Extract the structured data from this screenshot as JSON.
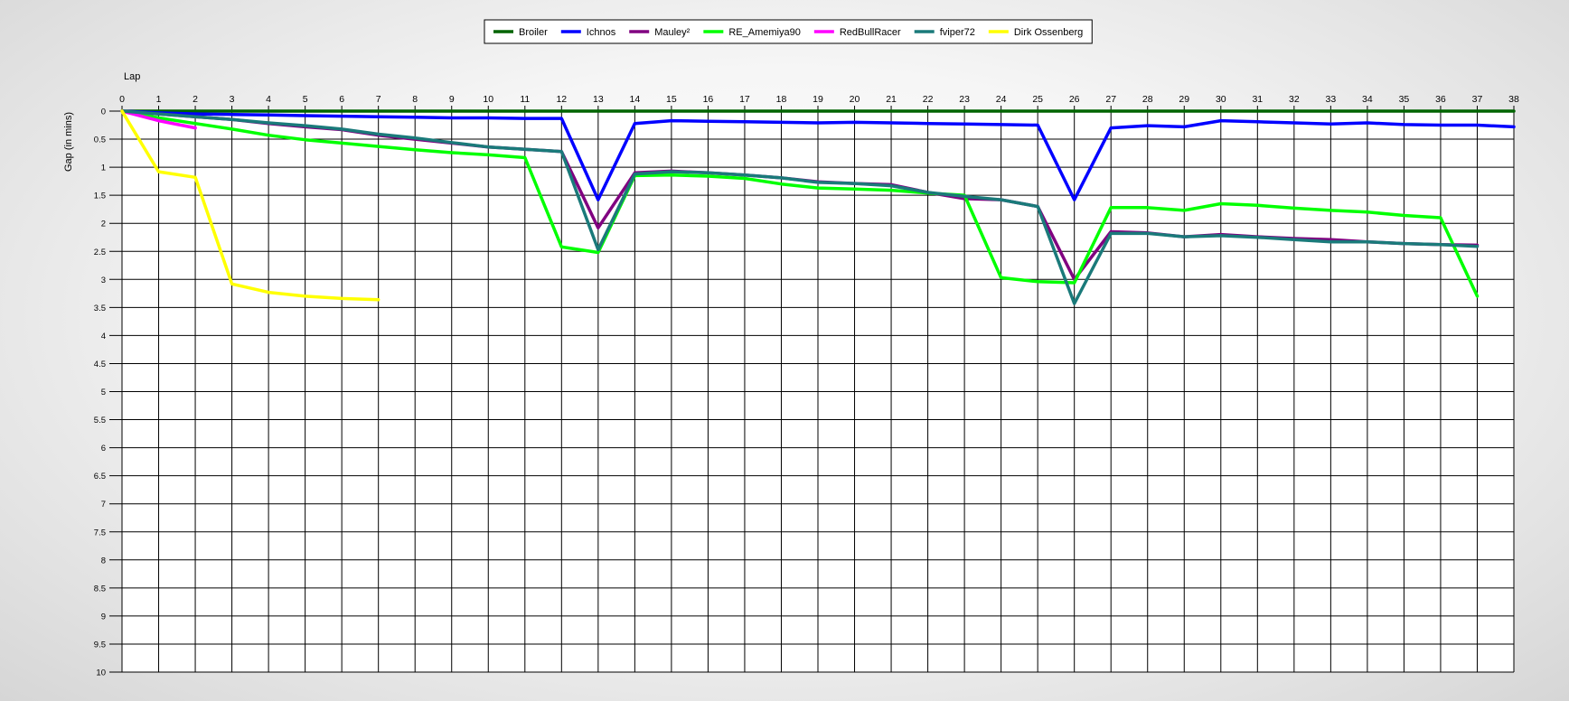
{
  "chart_data": {
    "type": "line",
    "xlabel": "Lap",
    "ylabel": "Gap (in mins)",
    "xlim": [
      0,
      38
    ],
    "ylim": [
      0,
      10
    ],
    "y_inverted": true,
    "x_ticks": [
      0,
      1,
      2,
      3,
      4,
      5,
      6,
      7,
      8,
      9,
      10,
      11,
      12,
      13,
      14,
      15,
      16,
      17,
      18,
      19,
      20,
      21,
      22,
      23,
      24,
      25,
      26,
      27,
      28,
      29,
      30,
      31,
      32,
      33,
      34,
      35,
      36,
      37,
      38
    ],
    "y_ticks": [
      "0",
      "0.5",
      "1",
      "1.5",
      "2",
      "2.5",
      "3",
      "3.5",
      "4",
      "4.5",
      "5",
      "5.5",
      "6",
      "6.5",
      "7",
      "7.5",
      "8",
      "8.5",
      "9",
      "9.5",
      "10"
    ],
    "grid": true,
    "legend_position": "top-center",
    "series": [
      {
        "name": "Broiler",
        "color": "#006400",
        "x": [
          0,
          1,
          2,
          3,
          4,
          5,
          6,
          7,
          8,
          9,
          10,
          11,
          12,
          13,
          14,
          15,
          16,
          17,
          18,
          19,
          20,
          21,
          22,
          23,
          24,
          25,
          26,
          27,
          28,
          29,
          30,
          31,
          32,
          33,
          34,
          35,
          36,
          37,
          38
        ],
        "y": [
          0,
          0,
          0,
          0,
          0,
          0,
          0,
          0,
          0,
          0,
          0,
          0,
          0,
          0,
          0,
          0,
          0,
          0,
          0,
          0,
          0,
          0,
          0,
          0,
          0,
          0,
          0,
          0,
          0,
          0,
          0,
          0,
          0,
          0,
          0,
          0,
          0,
          0,
          0
        ]
      },
      {
        "name": "Ichnos",
        "color": "#0000ff",
        "x": [
          0,
          1,
          2,
          3,
          4,
          5,
          6,
          7,
          8,
          9,
          10,
          11,
          12,
          13,
          14,
          15,
          16,
          17,
          18,
          19,
          20,
          21,
          22,
          23,
          24,
          25,
          26,
          27,
          28,
          29,
          30,
          31,
          32,
          33,
          34,
          35,
          36,
          37,
          38
        ],
        "y": [
          0,
          0.03,
          0.05,
          0.06,
          0.07,
          0.08,
          0.09,
          0.1,
          0.11,
          0.12,
          0.12,
          0.13,
          0.13,
          1.58,
          0.22,
          0.17,
          0.18,
          0.19,
          0.2,
          0.21,
          0.2,
          0.21,
          0.22,
          0.23,
          0.24,
          0.25,
          1.58,
          0.3,
          0.26,
          0.28,
          0.17,
          0.19,
          0.21,
          0.23,
          0.21,
          0.24,
          0.25,
          0.25,
          0.28
        ]
      },
      {
        "name": "Mauley²",
        "color": "#800080",
        "x": [
          0,
          1,
          2,
          3,
          4,
          5,
          6,
          7,
          8,
          9,
          10,
          11,
          12,
          13,
          14,
          15,
          16,
          17,
          18,
          19,
          20,
          21,
          22,
          23,
          24,
          25,
          26,
          27,
          28,
          29,
          30,
          31,
          32,
          33,
          34,
          35,
          36,
          37
        ],
        "y": [
          0,
          0.05,
          0.1,
          0.15,
          0.22,
          0.28,
          0.33,
          0.43,
          0.5,
          0.57,
          0.64,
          0.68,
          0.72,
          2.08,
          1.1,
          1.07,
          1.1,
          1.14,
          1.19,
          1.26,
          1.29,
          1.31,
          1.45,
          1.56,
          1.58,
          1.7,
          3.0,
          2.15,
          2.17,
          2.24,
          2.2,
          2.24,
          2.27,
          2.29,
          2.33,
          2.36,
          2.38,
          2.39
        ]
      },
      {
        "name": "RE_Amemiya90",
        "color": "#00ff00",
        "x": [
          0,
          1,
          2,
          3,
          4,
          5,
          6,
          7,
          8,
          9,
          10,
          11,
          12,
          13,
          14,
          15,
          16,
          17,
          18,
          19,
          20,
          21,
          22,
          23,
          24,
          25,
          26,
          27,
          28,
          29,
          30,
          31,
          32,
          33,
          34,
          35,
          36,
          37
        ],
        "y": [
          0,
          0.12,
          0.22,
          0.32,
          0.43,
          0.51,
          0.57,
          0.63,
          0.69,
          0.74,
          0.78,
          0.83,
          2.42,
          2.52,
          1.15,
          1.14,
          1.16,
          1.2,
          1.3,
          1.37,
          1.39,
          1.41,
          1.46,
          1.5,
          2.97,
          3.04,
          3.06,
          1.72,
          1.72,
          1.77,
          1.65,
          1.68,
          1.73,
          1.77,
          1.8,
          1.86,
          1.9,
          3.3
        ]
      },
      {
        "name": "RedBullRacer",
        "color": "#ff00ff",
        "x": [
          0,
          1,
          2
        ],
        "y": [
          0,
          0.17,
          0.3
        ]
      },
      {
        "name": "fviper72",
        "color": "#1a7a7a",
        "x": [
          0,
          1,
          2,
          3,
          4,
          5,
          6,
          7,
          8,
          9,
          10,
          11,
          12,
          13,
          14,
          15,
          16,
          17,
          18,
          19,
          20,
          21,
          22,
          23,
          24,
          25,
          26,
          27,
          28,
          29,
          30,
          31,
          32,
          33,
          34,
          35,
          36,
          37
        ],
        "y": [
          0,
          0.05,
          0.1,
          0.15,
          0.21,
          0.26,
          0.32,
          0.41,
          0.48,
          0.56,
          0.64,
          0.68,
          0.72,
          2.47,
          1.12,
          1.08,
          1.1,
          1.14,
          1.19,
          1.27,
          1.29,
          1.33,
          1.45,
          1.52,
          1.58,
          1.7,
          3.43,
          2.18,
          2.18,
          2.24,
          2.22,
          2.25,
          2.29,
          2.33,
          2.33,
          2.36,
          2.38,
          2.41
        ]
      },
      {
        "name": "Dirk Ossenberg",
        "color": "#ffff00",
        "x": [
          0,
          1,
          2,
          3,
          4,
          5,
          6,
          7
        ],
        "y": [
          0,
          1.08,
          1.18,
          3.08,
          3.23,
          3.3,
          3.34,
          3.36
        ]
      }
    ]
  }
}
